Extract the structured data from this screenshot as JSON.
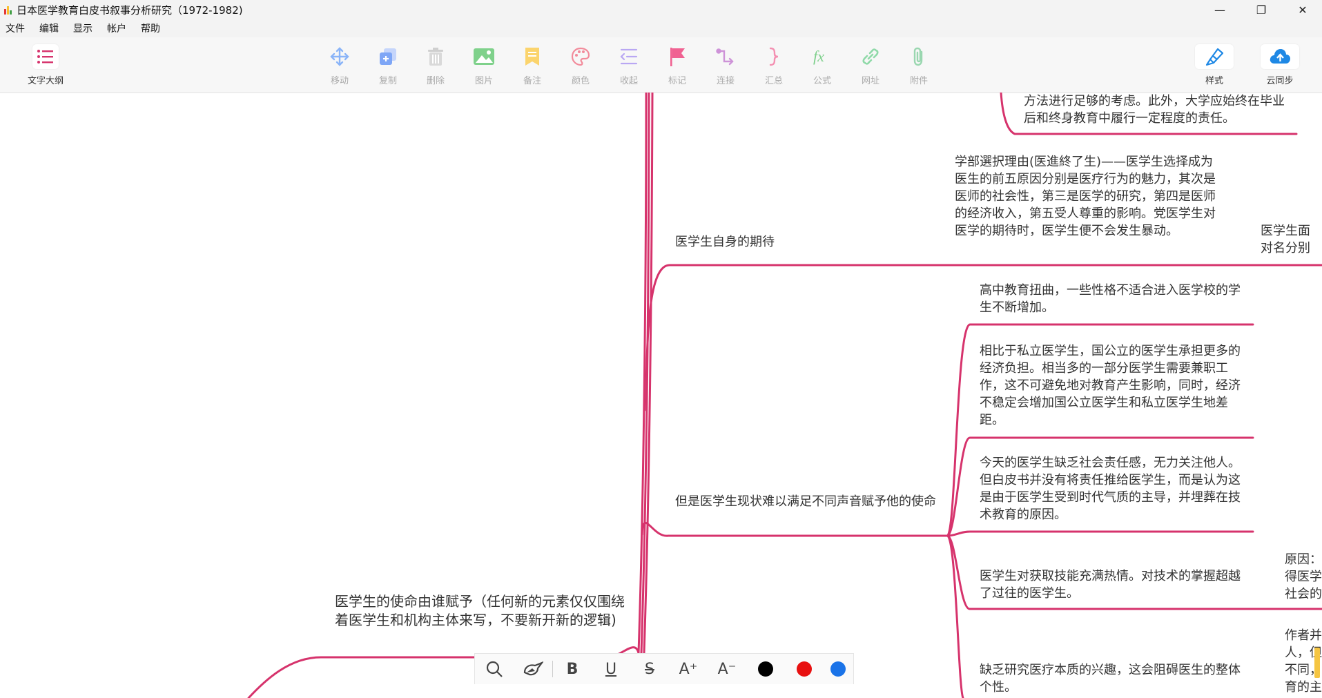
{
  "window": {
    "title": "日本医学教育白皮书叙事分析研究（1972-1982)",
    "minimize": "—",
    "maximize": "❐",
    "close": "✕"
  },
  "menu": [
    "文件",
    "编辑",
    "显示",
    "帐户",
    "帮助"
  ],
  "toolbar": {
    "outline": "文字大纲",
    "tools": [
      "移动",
      "复制",
      "删除",
      "图片",
      "备注",
      "颜色",
      "收起",
      "标记",
      "连接",
      "汇总",
      "公式",
      "网址",
      "附件"
    ],
    "style": "样式",
    "cloud": "云同步"
  },
  "mindmap": {
    "line_color": "#d6336c",
    "nodes": {
      "top_text": "方法进行足够的考虑。此外，大学应始终在毕业后和终身教育中履行一定程度的责任。",
      "reason": "学部選択理由(医進終了生)——医学生选择成为医生的前五原因分别是医疗行为的魅力，其次是医师的社会性，第三是医学的研究，第四是医师的经济收入，第五受人尊重的影响。党医学生对医学的期待时，医学生便不会发生暴动。",
      "right_cut_1": "医学生面对名分别为临",
      "expect": "医学生自身的期待",
      "hs": "高中教育扭曲，一些性格不适合进入医学校的学生不断增加。",
      "burden": "相比于私立医学生，国公立的医学生承担更多的经济负担。相当多的一部分医学生需要兼职工作，这不可避免地对教育产生影响，同时，经济不稳定会增加国公立医学生和私立医学生地差距。",
      "duty": "今天的医学生缺乏社会责任感，无力关注他人。但白皮书并没有将责任推给医学生，而是认为这是由于医学生受到时代气质的主导，并埋葬在技术教育的原因。",
      "mission_gap": "但是医学生现状难以满足不同声音赋予他的使命",
      "tech": "医学生对获取技能充满热情。对技术的掌握超越了过往的医学生。",
      "right_cut_2": "原因：得医学社会的",
      "mission_who": "医学生的使命由谁赋予（任何新的元素仅仅围绕着医学生和机构主体来写，不要新开新的逻辑)",
      "research": "缺乏研究医疗本质的兴趣，这会阻碍医生的整体个性。",
      "right_cut_3": "作者并人，但不同，育的主"
    }
  },
  "formatbar": {
    "tools": [
      "search-icon",
      "format-painter-icon",
      "bold",
      "underline",
      "strikethrough",
      "font-increase",
      "font-decrease"
    ],
    "bold": "B",
    "underline": "U",
    "strike": "S",
    "inc": "A⁺",
    "dec": "A⁻",
    "colors": [
      "#000000",
      "#e81010",
      "#1a73e8"
    ]
  }
}
